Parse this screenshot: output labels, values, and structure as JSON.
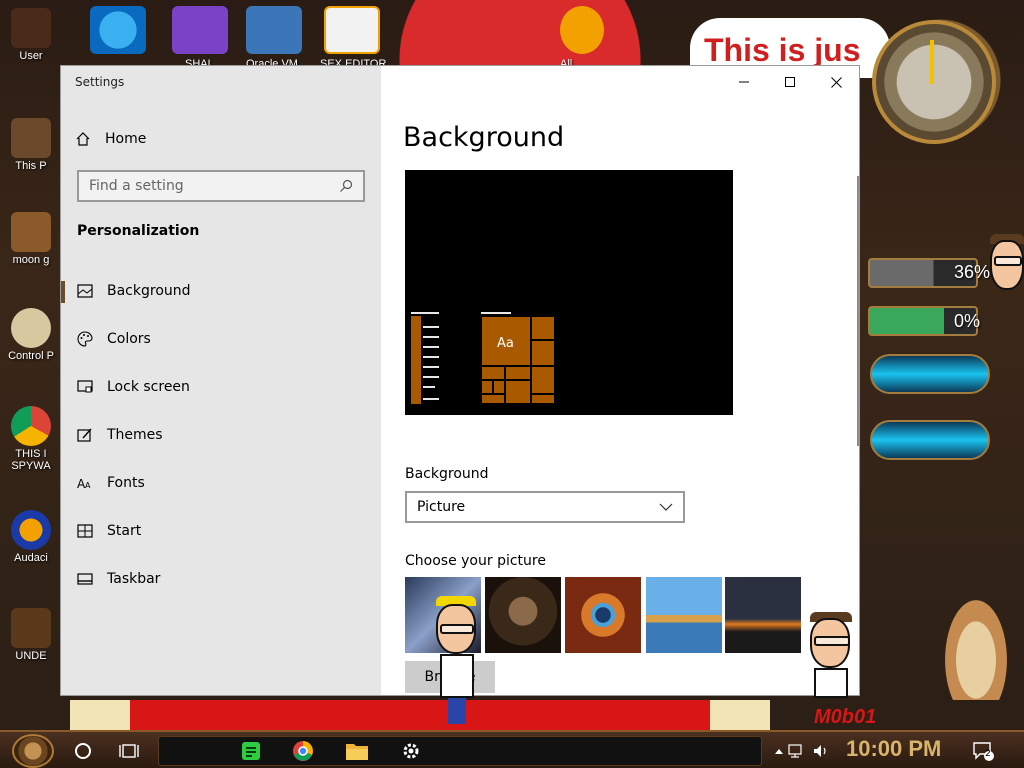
{
  "desktop": {
    "icons_left": [
      "User",
      "This P",
      "moon g",
      "Control P",
      "THIS I SPYWA",
      "Audaci",
      "UNDE"
    ],
    "icons_top": [
      "SHAL",
      "Oracle VM",
      "SEX EDITOR",
      "All"
    ],
    "banner_text": "This is jus",
    "gauge_1": "36%",
    "gauge_2": "0%",
    "watermark": "M0b01"
  },
  "window": {
    "app_title": "Settings",
    "controls": {
      "minimize": "minimize",
      "maximize": "maximize",
      "close": "close"
    }
  },
  "sidebar": {
    "home_label": "Home",
    "search_placeholder": "Find a setting",
    "section_header": "Personalization",
    "items": [
      {
        "label": "Background",
        "icon": "picture-icon",
        "selected": true
      },
      {
        "label": "Colors",
        "icon": "palette-icon",
        "selected": false
      },
      {
        "label": "Lock screen",
        "icon": "lock-screen-icon",
        "selected": false
      },
      {
        "label": "Themes",
        "icon": "themes-icon",
        "selected": false
      },
      {
        "label": "Fonts",
        "icon": "fonts-icon",
        "selected": false
      },
      {
        "label": "Start",
        "icon": "start-icon",
        "selected": false
      },
      {
        "label": "Taskbar",
        "icon": "taskbar-icon",
        "selected": false
      }
    ]
  },
  "main": {
    "page_title": "Background",
    "preview_sample_text": "Aa",
    "background_label": "Background",
    "background_value": "Picture",
    "choose_picture_label": "Choose your picture",
    "browse_label": "Browse",
    "accent_color": "#a95a00"
  },
  "taskbar": {
    "time": "10:00 PM",
    "notifications_count": "2"
  }
}
